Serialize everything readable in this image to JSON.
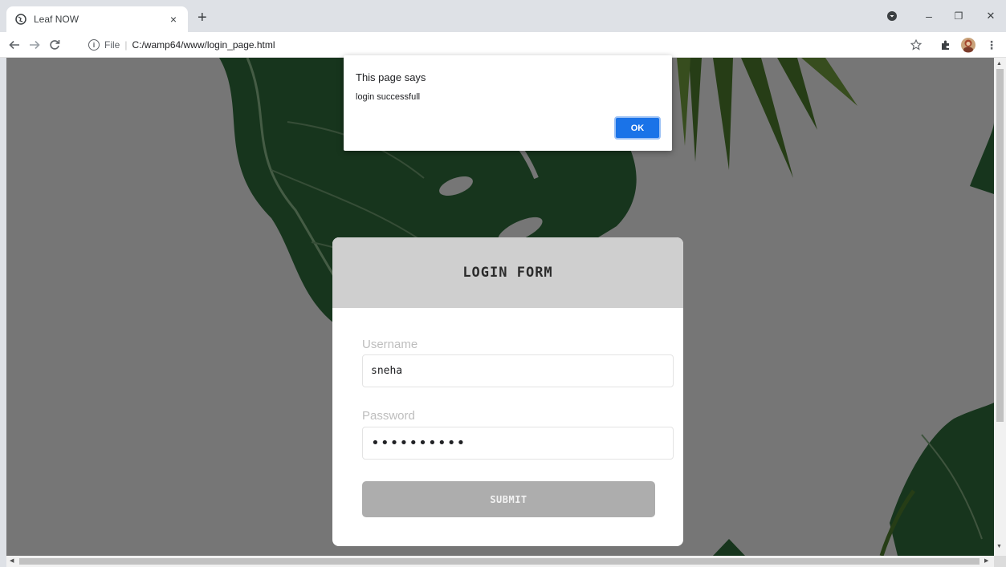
{
  "browser": {
    "tab_title": "Leaf NOW",
    "tab_close_glyph": "×",
    "new_tab_glyph": "+",
    "scheme_label": "File",
    "url": "C:/wamp64/www/login_page.html",
    "window_controls": {
      "minimize": "–",
      "restore": "❐",
      "close": "✕"
    }
  },
  "alert": {
    "title": "This page says",
    "message": "login successfull",
    "ok_label": "OK"
  },
  "login_form": {
    "title": "LOGIN FORM",
    "username_label": "Username",
    "username_value": "sneha",
    "password_label": "Password",
    "password_masked": "••••••••••",
    "submit_label": "SUBMIT"
  },
  "colors": {
    "accent": "#1a73e8",
    "card_header": "#cfcfcf",
    "submit_button": "#adadad",
    "page_overlay": "rgba(0,0,0,0.5)"
  },
  "icons": [
    "globe-icon",
    "close-icon",
    "plus-icon",
    "back-arrow-icon",
    "forward-arrow-icon",
    "reload-icon",
    "info-icon",
    "star-icon",
    "extensions-icon",
    "avatar",
    "more-menu-icon",
    "account-circle-icon"
  ]
}
